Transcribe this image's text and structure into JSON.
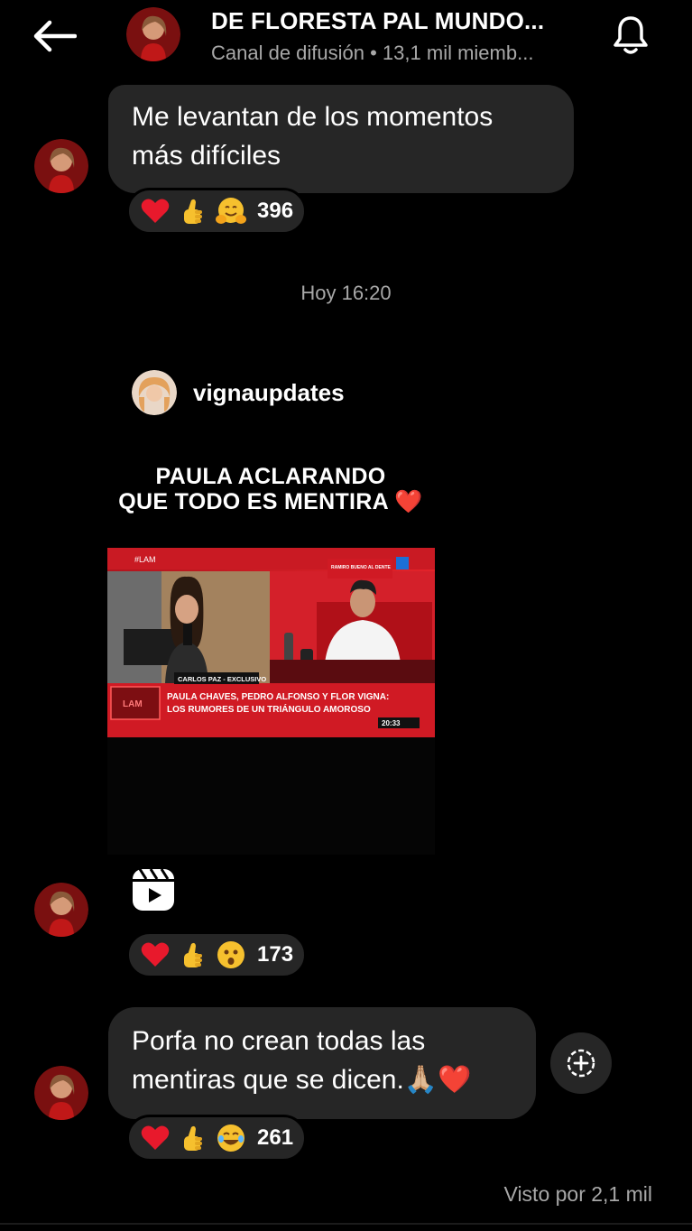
{
  "header": {
    "title": "DE FLORESTA PAL MUNDO...",
    "subtitle": "Canal de difusión • 13,1 mil miemb..."
  },
  "messages": [
    {
      "text_line1": "Me levantan de los momentos",
      "text_line2": "más difíciles",
      "reactions": [
        "red-heart",
        "thumbs-up",
        "hugging-face"
      ],
      "count": "396"
    },
    {
      "shared_post": {
        "username": "vignaupdates",
        "caption_line1": "PAULA ACLARANDO",
        "caption_line2": "QUE TODO ES MENTIRA ❤️",
        "video": {
          "tag": "#LAM",
          "location": "CARLOS PAZ - EXCLUSIVO",
          "headline_line1": "PAULA CHAVES, PEDRO ALFONSO Y FLOR VIGNA:",
          "headline_line2": "LOS RUMORES DE UN TRIÁNGULO AMOROSO",
          "clock": "20:33",
          "corner_text": "RAMIRO BUENO AL DENTE",
          "logo": "LAM"
        }
      },
      "reactions": [
        "red-heart",
        "thumbs-up",
        "astonished-face"
      ],
      "count": "173"
    },
    {
      "text_line1": "Porfa no crean todas las",
      "text_line2": "mentiras que se dicen.🙏🏼❤️",
      "reactions": [
        "red-heart",
        "thumbs-up",
        "joy-face"
      ],
      "count": "261"
    }
  ],
  "timestamp": "Hoy 16:20",
  "seen_by": "Visto por 2,1 mil",
  "colors": {
    "background": "#000000",
    "bubble": "#262626",
    "muted_text": "#a8a8a8"
  }
}
